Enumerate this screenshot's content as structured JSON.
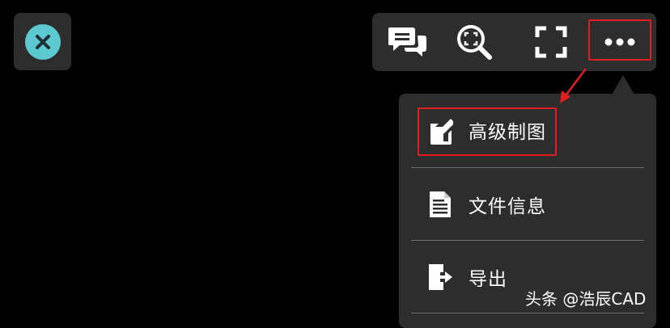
{
  "toolbar": {
    "close_icon": "close-icon",
    "buttons": [
      {
        "icon": "chat-icon"
      },
      {
        "icon": "zoom-search-icon"
      },
      {
        "icon": "fullscreen-icon"
      },
      {
        "icon": "more-icon"
      }
    ]
  },
  "menu": {
    "items": [
      {
        "label": "高级制图",
        "icon": "edit-drawing-icon"
      },
      {
        "label": "文件信息",
        "icon": "file-info-icon"
      },
      {
        "label": "导出",
        "icon": "export-icon"
      }
    ]
  },
  "annotations": {
    "highlight_color": "#e02020"
  },
  "watermark": {
    "text": "头条 @浩辰CAD"
  },
  "colors": {
    "panel": "#2d2d2d",
    "close_accent": "#5cc9d0",
    "background": "#000000"
  }
}
